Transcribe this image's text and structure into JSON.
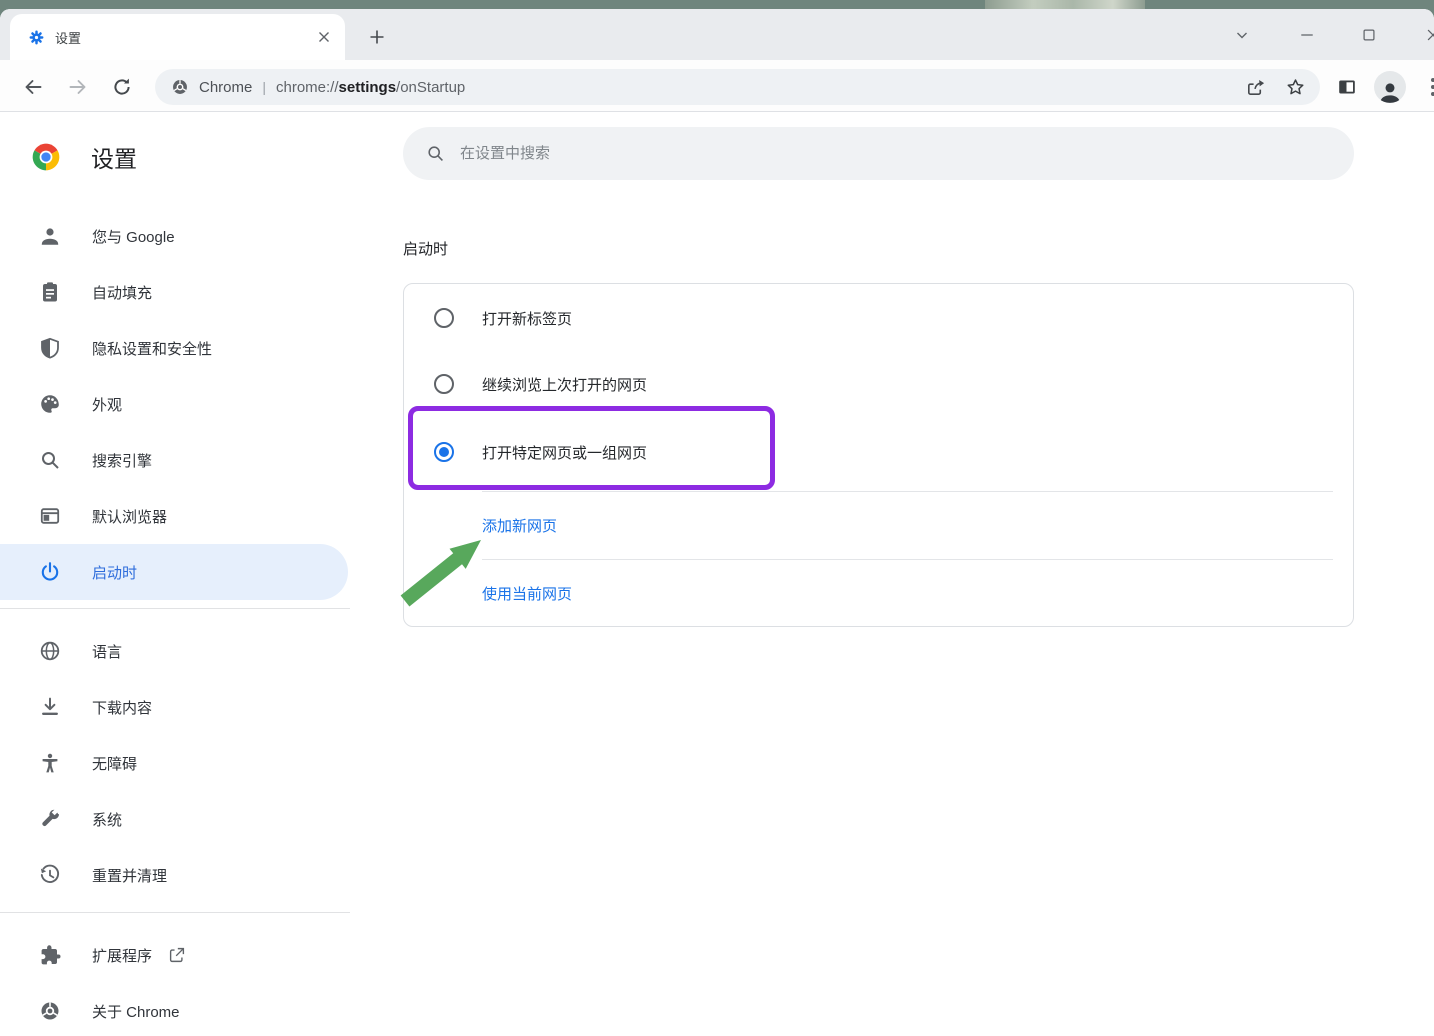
{
  "window": {
    "tab": {
      "title": "设置",
      "favicon": "gear-icon"
    },
    "controls": [
      "tab-search-chevron-icon",
      "minimize-icon",
      "maximize-icon",
      "close-icon"
    ]
  },
  "toolbar": {
    "site_label": "Chrome",
    "separator": "|",
    "url": {
      "scheme": "chrome://",
      "section": "settings",
      "path": "/onStartup"
    },
    "icons": [
      "back-icon",
      "forward-icon",
      "reload-icon",
      "chrome-glyph-icon",
      "share-icon",
      "bookmark-star-icon",
      "side-panel-icon",
      "profile-avatar",
      "overflow-menu-icon"
    ]
  },
  "sidebar": {
    "title": "设置",
    "items": [
      {
        "label": "您与 Google",
        "icon": "person-icon",
        "selected": false
      },
      {
        "label": "自动填充",
        "icon": "autofill-icon",
        "selected": false
      },
      {
        "label": "隐私设置和安全性",
        "icon": "shield-icon",
        "selected": false
      },
      {
        "label": "外观",
        "icon": "palette-icon",
        "selected": false
      },
      {
        "label": "搜索引擎",
        "icon": "search-icon",
        "selected": false
      },
      {
        "label": "默认浏览器",
        "icon": "browser-window-icon",
        "selected": false
      },
      {
        "label": "启动时",
        "icon": "power-icon",
        "selected": true
      },
      {
        "label": "语言",
        "icon": "globe-icon",
        "selected": false
      },
      {
        "label": "下载内容",
        "icon": "download-icon",
        "selected": false
      },
      {
        "label": "无障碍",
        "icon": "accessibility-icon",
        "selected": false
      },
      {
        "label": "系统",
        "icon": "wrench-icon",
        "selected": false
      },
      {
        "label": "重置并清理",
        "icon": "history-icon",
        "selected": false
      },
      {
        "label": "扩展程序",
        "icon": "puzzle-icon",
        "selected": false,
        "external_link": true
      },
      {
        "label": "关于 Chrome",
        "icon": "chrome-logo-icon",
        "selected": false
      }
    ]
  },
  "main": {
    "search_placeholder": "在设置中搜索",
    "section_title": "启动时",
    "startup_options": [
      {
        "label": "打开新标签页",
        "selected": false
      },
      {
        "label": "继续浏览上次打开的网页",
        "selected": false
      },
      {
        "label": "打开特定网页或一组网页",
        "selected": true
      }
    ],
    "actions": [
      {
        "label": "添加新网页"
      },
      {
        "label": "使用当前网页"
      }
    ]
  },
  "annotations": {
    "highlight_box_color": "#8d2be2",
    "arrow_color": "#58a85c"
  },
  "colors": {
    "accent_blue": "#1a73e8",
    "selected_item_bg": "#e6effc",
    "link_blue": "#1a73e8",
    "tabstrip_bg": "#e9ebee",
    "desktop_strip": "#6f857d"
  }
}
